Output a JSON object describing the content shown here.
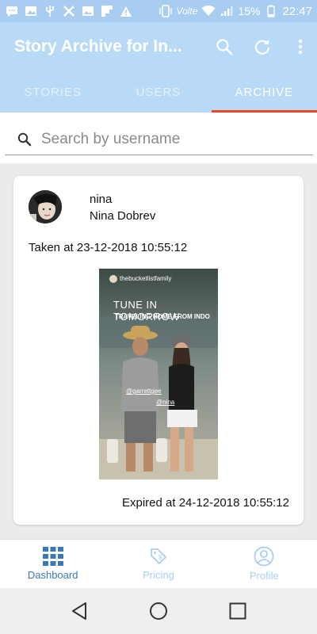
{
  "status_bar": {
    "battery": "15%",
    "time": "22:47",
    "network": "Volte",
    "icons": [
      "message-icon",
      "image-icon",
      "usb-icon",
      "tools-icon",
      "gallery-icon",
      "flipboard-icon",
      "warning-icon",
      "vibrate-icon",
      "wifi-icon",
      "signal-icon",
      "battery-icon"
    ]
  },
  "app_bar": {
    "title": "Story Archive for In...",
    "actions": [
      "search-icon",
      "refresh-icon",
      "more-vert-icon"
    ]
  },
  "tabs": [
    {
      "label": "STORIES",
      "active": false
    },
    {
      "label": "USERS",
      "active": false
    },
    {
      "label": "ARCHIVE",
      "active": true
    }
  ],
  "search": {
    "placeholder": "Search by username",
    "value": ""
  },
  "story_card": {
    "username": "nina",
    "full_name": "Nina Dobrev",
    "taken_at": "Taken at 23-12-2018 10:55:12",
    "expired_at": "Expired at 24-12-2018 10:55:12",
    "story": {
      "account": "thebucketlistfamily",
      "headline": "TUNE IN TOMORROW",
      "subline": "TRAVELING HOME FROM INDO",
      "tags": [
        "@garrettgee",
        "@nina"
      ]
    }
  },
  "bottom_nav": [
    {
      "label": "Dashboard",
      "icon": "dashboard-grid-icon",
      "active": true
    },
    {
      "label": "Pricing",
      "icon": "price-tag-icon",
      "active": false
    },
    {
      "label": "Profile",
      "icon": "profile-icon",
      "active": false
    }
  ],
  "colors": {
    "app_bar": "#b9daf6",
    "status_bar": "#a9cdf0",
    "tab_indicator": "#e8472b",
    "nav_active": "#3a78b8",
    "nav_inactive": "#a9cdf0"
  }
}
